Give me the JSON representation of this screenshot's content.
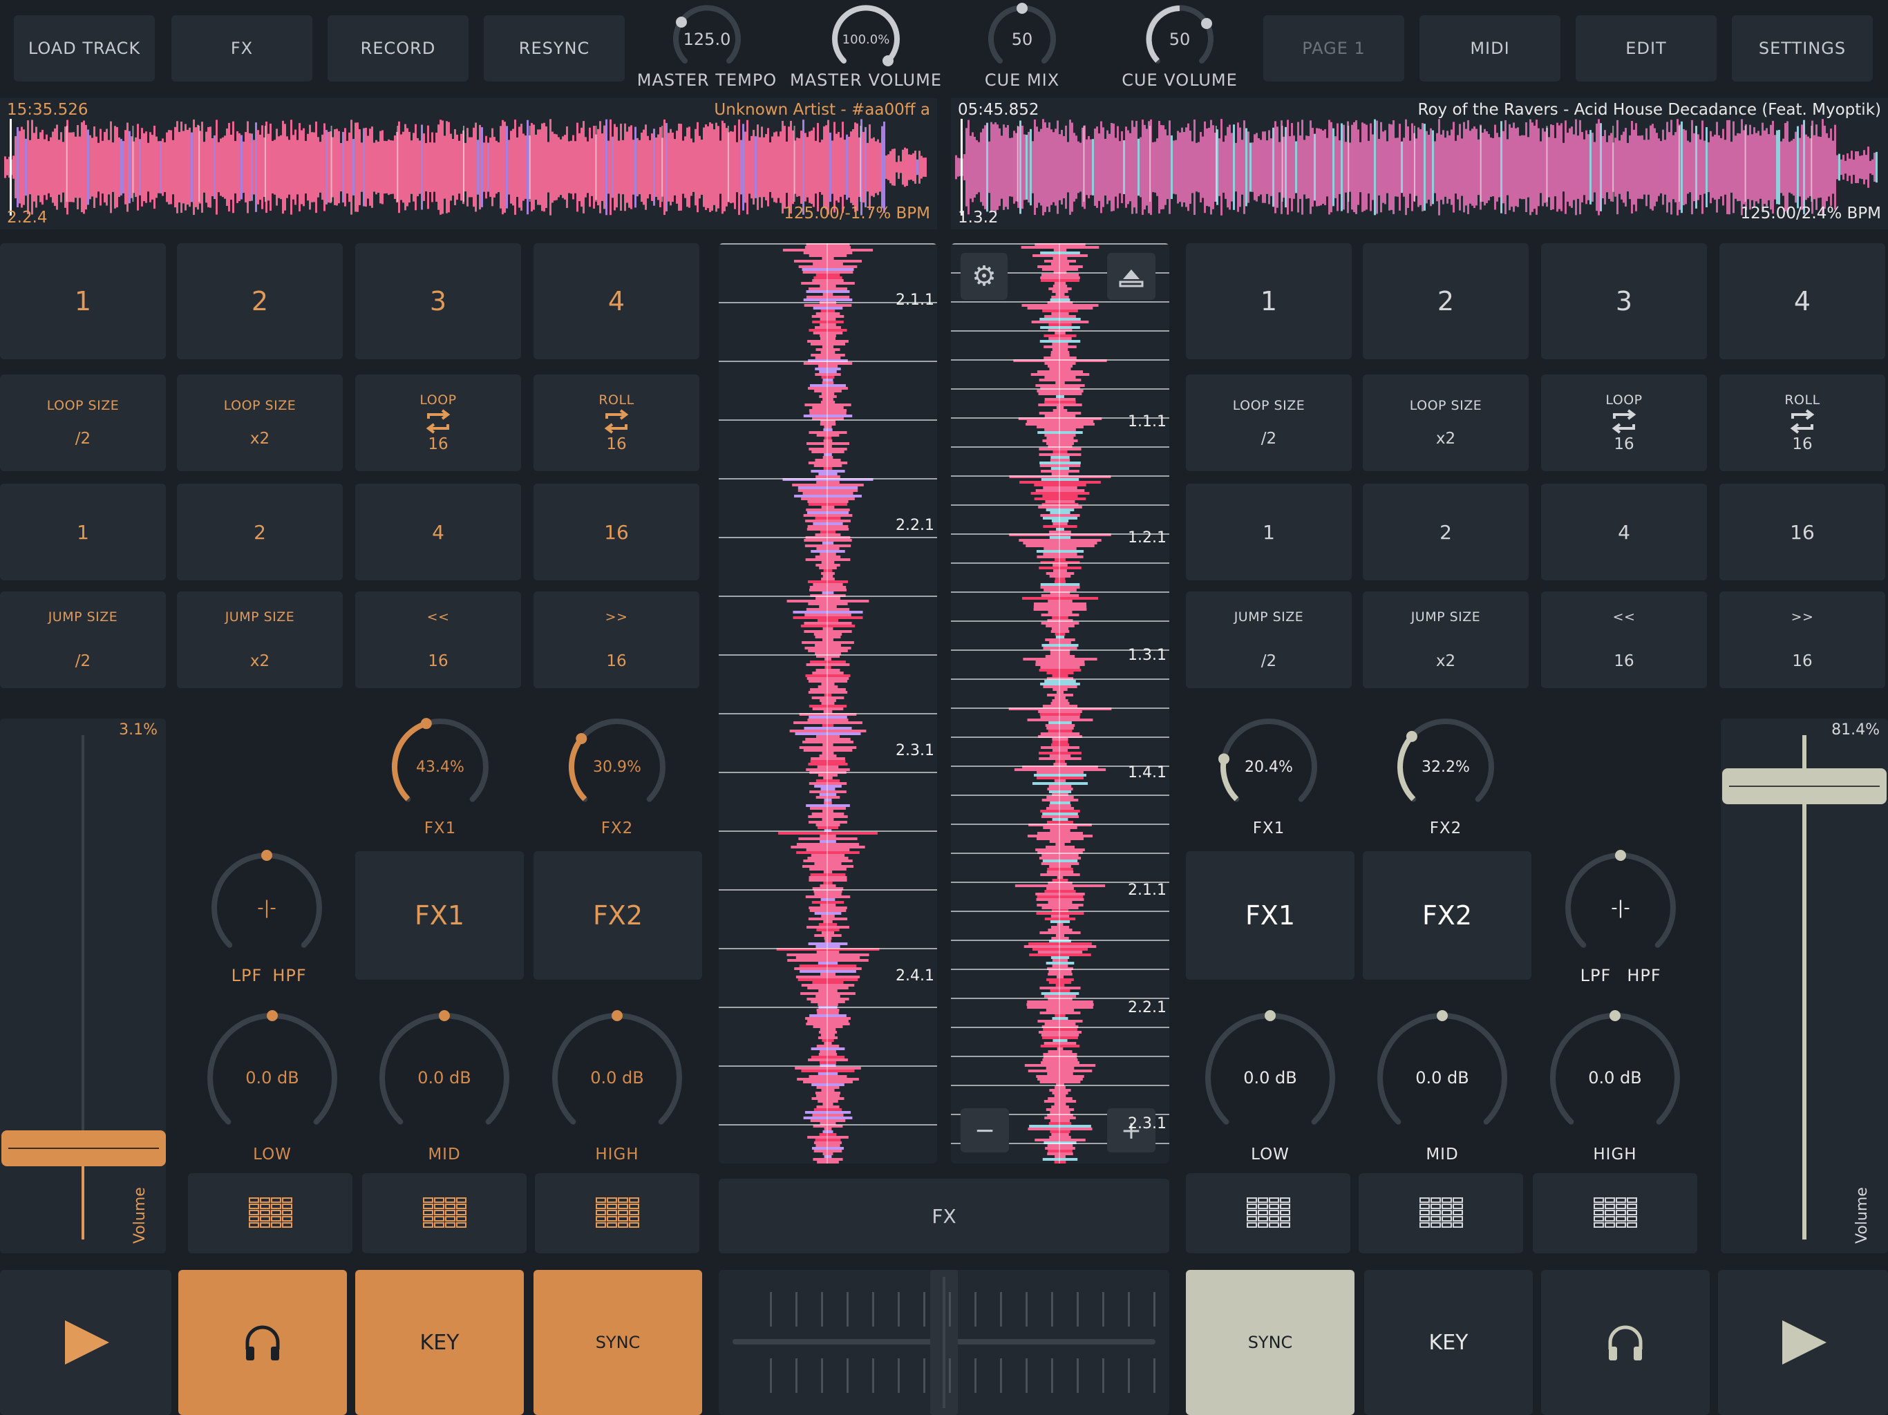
{
  "colors": {
    "accent_left": "#e19a58",
    "accent_right": "#c9c9b8",
    "bg": "#1b2026",
    "panel": "#262c33",
    "wave_pink": "#ff6f9c"
  },
  "toolbar": {
    "load_track": "LOAD TRACK",
    "fx": "FX",
    "record": "RECORD",
    "resync": "RESYNC",
    "page1": "PAGE 1",
    "midi": "MIDI",
    "edit": "EDIT",
    "settings": "SETTINGS"
  },
  "master": {
    "tempo": {
      "value": "125.0",
      "label": "MASTER TEMPO"
    },
    "volume": {
      "value": "100.0%",
      "label": "MASTER VOLUME",
      "level": 1.0
    },
    "cue_mix": {
      "value": "50",
      "label": "CUE MIX",
      "level": 0.5
    },
    "cue_volume": {
      "value": "50",
      "label": "CUE VOLUME",
      "level": 0.5
    }
  },
  "deckA": {
    "time": "15:35.526",
    "title": "Unknown Artist - #aa00ff a",
    "beat": "2.2.4",
    "bpm": "125.00/-1.7% BPM",
    "hotcues": [
      "1",
      "2",
      "3",
      "4"
    ],
    "loop_row": [
      {
        "top": "LOOP SIZE",
        "bottom": "/2"
      },
      {
        "top": "LOOP SIZE",
        "bottom": "x2"
      },
      {
        "top": "LOOP",
        "bottom": "16",
        "icon": "loop-icon"
      },
      {
        "top": "ROLL",
        "bottom": "16",
        "icon": "loop-icon"
      }
    ],
    "jump_values": [
      "1",
      "2",
      "4",
      "16"
    ],
    "jump_row": [
      {
        "top": "JUMP SIZE",
        "bottom": "/2"
      },
      {
        "top": "JUMP SIZE",
        "bottom": "x2"
      },
      {
        "top": "<<",
        "bottom": "16"
      },
      {
        "top": ">>",
        "bottom": "16"
      }
    ],
    "fx1_knob": {
      "value": "43.4%",
      "label": "FX1",
      "level": 0.434
    },
    "fx2_knob": {
      "value": "30.9%",
      "label": "FX2",
      "level": 0.309
    },
    "filter": {
      "value": "-|-",
      "lpf": "LPF",
      "hpf": "HPF"
    },
    "fx1_btn": "FX1",
    "fx2_btn": "FX2",
    "eq": [
      {
        "value": "0.0 dB",
        "label": "LOW"
      },
      {
        "value": "0.0 dB",
        "label": "MID"
      },
      {
        "value": "0.0 dB",
        "label": "HIGH"
      }
    ],
    "volume": {
      "value": "3.1%",
      "label": "Volume",
      "level": 0.031
    },
    "key": "KEY",
    "sync": "SYNC",
    "markers": [
      "2.1.1",
      "2.2.1",
      "2.3.1",
      "2.4.1"
    ]
  },
  "deckB": {
    "time": "05:45.852",
    "title": "Roy of the Ravers - Acid House Decadance (Feat. Myoptik)",
    "beat": "1.3.2",
    "bpm": "125.00/2.4% BPM",
    "hotcues": [
      "1",
      "2",
      "3",
      "4"
    ],
    "loop_row": [
      {
        "top": "LOOP SIZE",
        "bottom": "/2"
      },
      {
        "top": "LOOP SIZE",
        "bottom": "x2"
      },
      {
        "top": "LOOP",
        "bottom": "16",
        "icon": "loop-icon"
      },
      {
        "top": "ROLL",
        "bottom": "16",
        "icon": "loop-icon"
      }
    ],
    "jump_values": [
      "1",
      "2",
      "4",
      "16"
    ],
    "jump_row": [
      {
        "top": "JUMP SIZE",
        "bottom": "/2"
      },
      {
        "top": "JUMP SIZE",
        "bottom": "x2"
      },
      {
        "top": "<<",
        "bottom": "16"
      },
      {
        "top": ">>",
        "bottom": "16"
      }
    ],
    "fx1_knob": {
      "value": "20.4%",
      "label": "FX1",
      "level": 0.204
    },
    "fx2_knob": {
      "value": "32.2%",
      "label": "FX2",
      "level": 0.322
    },
    "filter": {
      "value": "-|-",
      "lpf": "LPF",
      "hpf": "HPF"
    },
    "fx1_btn": "FX1",
    "fx2_btn": "FX2",
    "eq": [
      {
        "value": "0.0 dB",
        "label": "LOW"
      },
      {
        "value": "0.0 dB",
        "label": "MID"
      },
      {
        "value": "0.0 dB",
        "label": "HIGH"
      }
    ],
    "volume": {
      "value": "81.4%",
      "label": "Volume",
      "level": 0.814
    },
    "key": "KEY",
    "sync": "SYNC",
    "markers": [
      "1.1.1",
      "1.2.1",
      "1.3.1",
      "1.4.1",
      "2.1.1",
      "2.2.1",
      "2.3.1"
    ]
  },
  "center": {
    "fx": "FX",
    "crossfader_level": 0.5
  }
}
